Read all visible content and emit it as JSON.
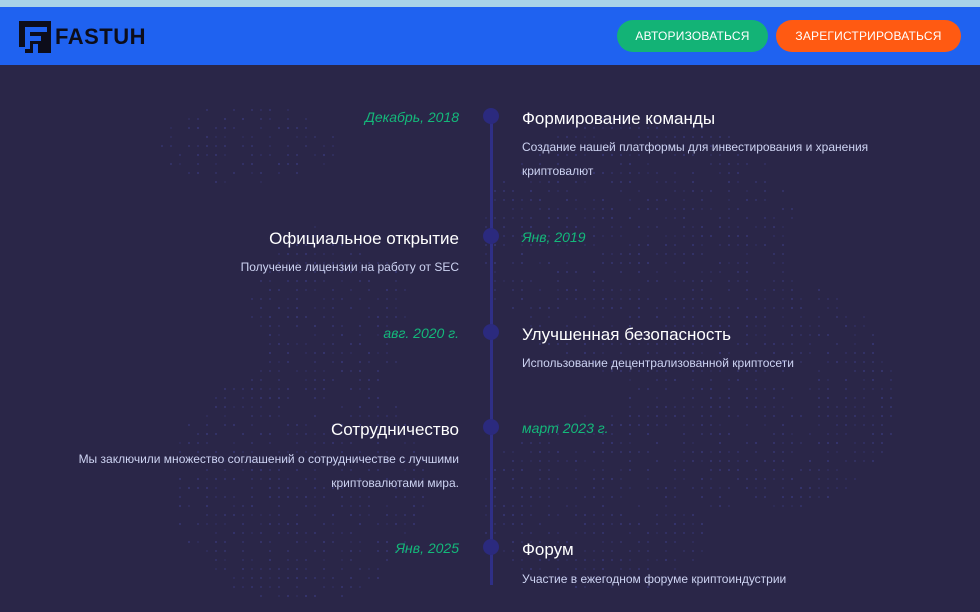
{
  "header": {
    "logo_text": "FASTUH",
    "login_label": "АВТОРИЗОВАТЬСЯ",
    "register_label": "ЗАРЕГИСТРИРОВАТЬСЯ"
  },
  "colors": {
    "header_bg": "#1f62f0",
    "page_bg": "#2a2648",
    "login_button": "#13b376",
    "register_button": "#ff5a12",
    "date_text": "#14b87a",
    "timeline": "#2f2f86"
  },
  "timeline": [
    {
      "date": "Декабрь, 2018",
      "title": "Формирование команды",
      "description_lines": [
        "Создание нашей платформы для инвестирования и хранения",
        "криптовалют"
      ]
    },
    {
      "date": "Янв, 2019",
      "title": "Официальное открытие",
      "description_lines": [
        "Получение лицензии на работу от SEC"
      ]
    },
    {
      "date": "авг. 2020 г.",
      "title": "Улучшенная безопасность",
      "description_lines": [
        "Использование децентрализованной криптосети"
      ]
    },
    {
      "date": "март 2023 г.",
      "title": "Сотрудничество",
      "description_lines": [
        "Мы заключили множество соглашений о сотрудничестве с лучшими",
        "криптовалютами мира."
      ]
    },
    {
      "date": "Янв, 2025",
      "title": "Форум",
      "description_lines": [
        "Участие в ежегодном форуме криптоиндустрии"
      ]
    }
  ]
}
